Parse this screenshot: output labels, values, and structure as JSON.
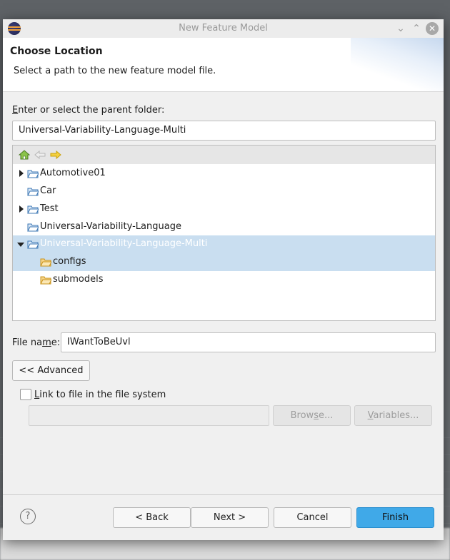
{
  "window": {
    "title": "New Feature Model"
  },
  "header": {
    "title": "Choose Location",
    "message": "Select a path to the new feature model file."
  },
  "parent_folder": {
    "label_first": "E",
    "label_rest": "nter or select the parent folder:",
    "value": "Universal-Variability-Language-Multi"
  },
  "tree": {
    "items": [
      {
        "label": "Automotive01",
        "expandable": "collapsed"
      },
      {
        "label": "Car"
      },
      {
        "label": "Test",
        "expandable": "collapsed"
      },
      {
        "label": "Universal-Variability-Language"
      },
      {
        "label": "Universal-Variability-Language-Multi",
        "expandable": "expanded",
        "selected": true
      },
      {
        "label": "configs",
        "selected": true
      },
      {
        "label": "submodels"
      }
    ]
  },
  "file_name": {
    "label_pre": "File na",
    "label_underline": "m",
    "label_post": "e:",
    "value": "IWantToBeUvl"
  },
  "advanced_button": "<< Advanced",
  "link": {
    "label_first": "L",
    "label_rest": "ink to file in the file system",
    "checked": false,
    "path_value": ""
  },
  "browse_button": {
    "label_pre": "Brow",
    "label_underline": "s",
    "label_post": "e..."
  },
  "variables_button": {
    "label_underline": "V",
    "label_post": "ariables..."
  },
  "footer": {
    "help": "?",
    "back_button": "< Back",
    "next_button": "Next >",
    "cancel_button": "Cancel",
    "finish_button": "Finish"
  },
  "colors": {
    "accent": "#40a9e8",
    "selection": "#c9def0"
  }
}
